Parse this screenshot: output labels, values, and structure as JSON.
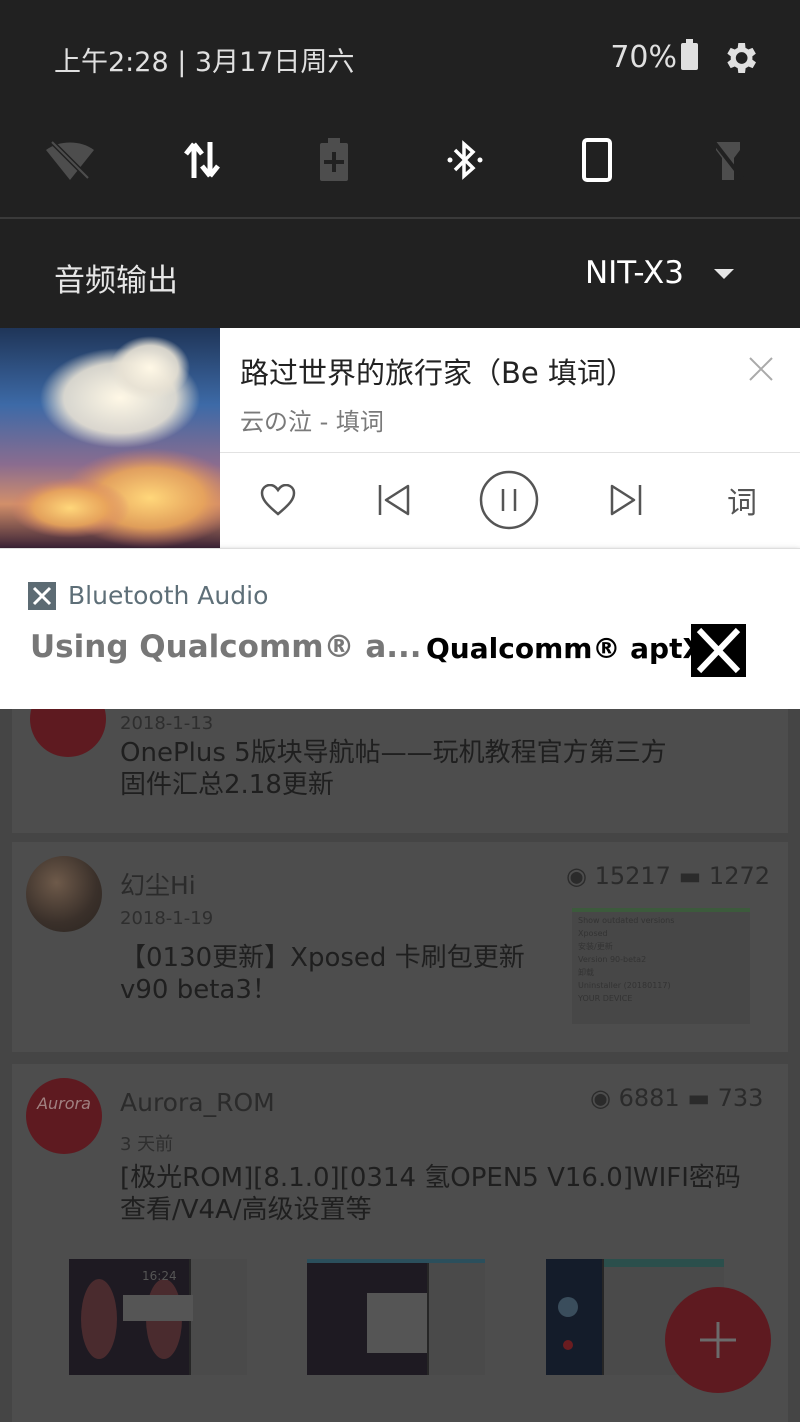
{
  "status": {
    "date_text": "上午2:28 | 3月17日周六",
    "battery_percent": "70%",
    "icons": [
      "settings-gear-icon"
    ]
  },
  "quick_tiles": [
    {
      "name": "wifi-off-icon",
      "active": false
    },
    {
      "name": "mobile-data-icon",
      "active": true
    },
    {
      "name": "battery-saver-icon",
      "active": false
    },
    {
      "name": "bluetooth-icon",
      "active": true
    },
    {
      "name": "auto-rotate-icon",
      "active": true
    },
    {
      "name": "flashlight-icon",
      "active": false
    }
  ],
  "audio_output": {
    "label": "音频输出",
    "device": "NIT-X3"
  },
  "music": {
    "title": "路过世界的旅行家（Be 填词）",
    "subtitle": "云の泣 - 填词",
    "lyric_label": "词"
  },
  "bluetooth": {
    "app_name": "Bluetooth Audio",
    "message": "Using Qualcomm® a...",
    "logo_text": "Qualcomm® aptX™"
  },
  "feed": {
    "posts": [
      {
        "date": "2018-1-13",
        "title_line1": "OnePlus 5版块导航帖——玩机教程官方第三方",
        "title_line2": "固件汇总2.18更新"
      },
      {
        "author": "幻尘Hi",
        "date": "2018-1-19",
        "views": "15217",
        "comments": "1272",
        "title_line1": "【0130更新】Xposed 卡刷包更新",
        "title_line2": "v90 beta3！",
        "thumb_lines": [
          "Show outdated versions",
          "Xposed",
          "安装/更新",
          "Version 90-beta2",
          "卸载",
          "Uninstaller (20180117)",
          "YOUR DEVICE"
        ]
      },
      {
        "author": "Aurora_ROM",
        "avatar_text": "Aurora",
        "date": "3 天前",
        "views": "6881",
        "comments": "733",
        "title_line1": "[极光ROM][8.1.0][0314 氢OPEN5 V16.0]WIFI密码",
        "title_line2": "查看/V4A/高级设置等",
        "thumb_time": "16:24"
      }
    ]
  },
  "fab": {
    "icon": "add-icon"
  },
  "colors": {
    "shade_bg": "#212121",
    "fab": "#c4112a",
    "dim_fab": "#5e1a20"
  }
}
